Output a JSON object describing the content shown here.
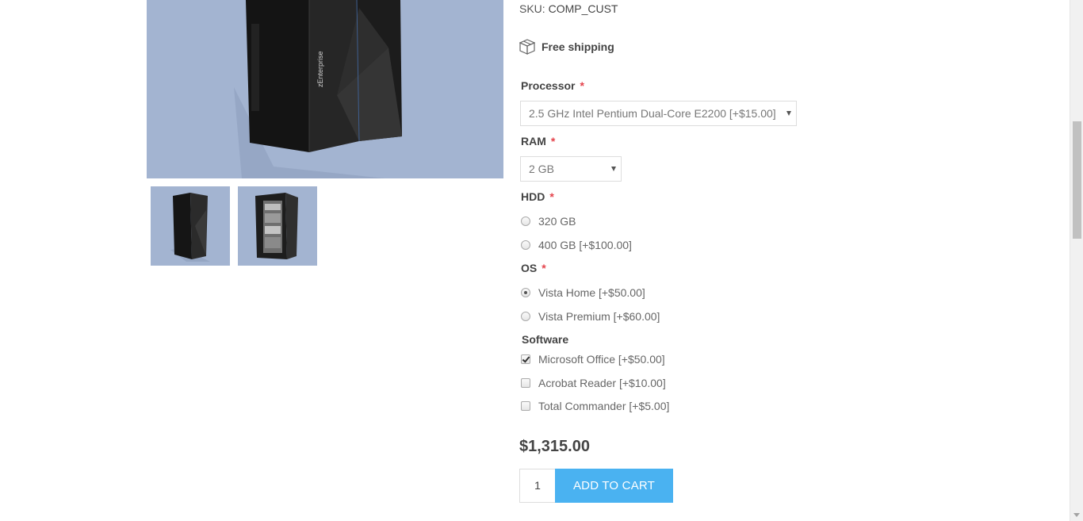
{
  "product": {
    "sku_label": "SKU:",
    "sku_value": "COMP_CUST",
    "shipping_text": "Free shipping",
    "price": "$1,315.00",
    "quantity": "1",
    "add_to_cart_label": "ADD TO CART"
  },
  "pictures": {
    "main_icon": "server-tower-image",
    "thumbnails": [
      "server-tower-closed-image",
      "server-tower-open-image"
    ]
  },
  "attributes": {
    "processor": {
      "label": "Processor",
      "required_mark": "*",
      "selected": "2.5 GHz Intel Pentium Dual-Core E2200 [+$15.00]"
    },
    "ram": {
      "label": "RAM",
      "required_mark": "*",
      "selected": "2 GB"
    },
    "hdd": {
      "label": "HDD",
      "required_mark": "*",
      "options": [
        {
          "label": "320 GB",
          "checked": false
        },
        {
          "label": "400 GB [+$100.00]",
          "checked": false
        }
      ]
    },
    "os": {
      "label": "OS",
      "required_mark": "*",
      "options": [
        {
          "label": "Vista Home [+$50.00]",
          "checked": true
        },
        {
          "label": "Vista Premium [+$60.00]",
          "checked": false
        }
      ]
    },
    "software": {
      "label": "Software",
      "options": [
        {
          "label": "Microsoft Office [+$50.00]",
          "checked": true
        },
        {
          "label": "Acrobat Reader [+$10.00]",
          "checked": false
        },
        {
          "label": "Total Commander [+$5.00]",
          "checked": false
        }
      ]
    }
  },
  "colors": {
    "accent": "#4ab2f1",
    "required": "#e4434b",
    "picture_bg": "#a3b4d1"
  }
}
